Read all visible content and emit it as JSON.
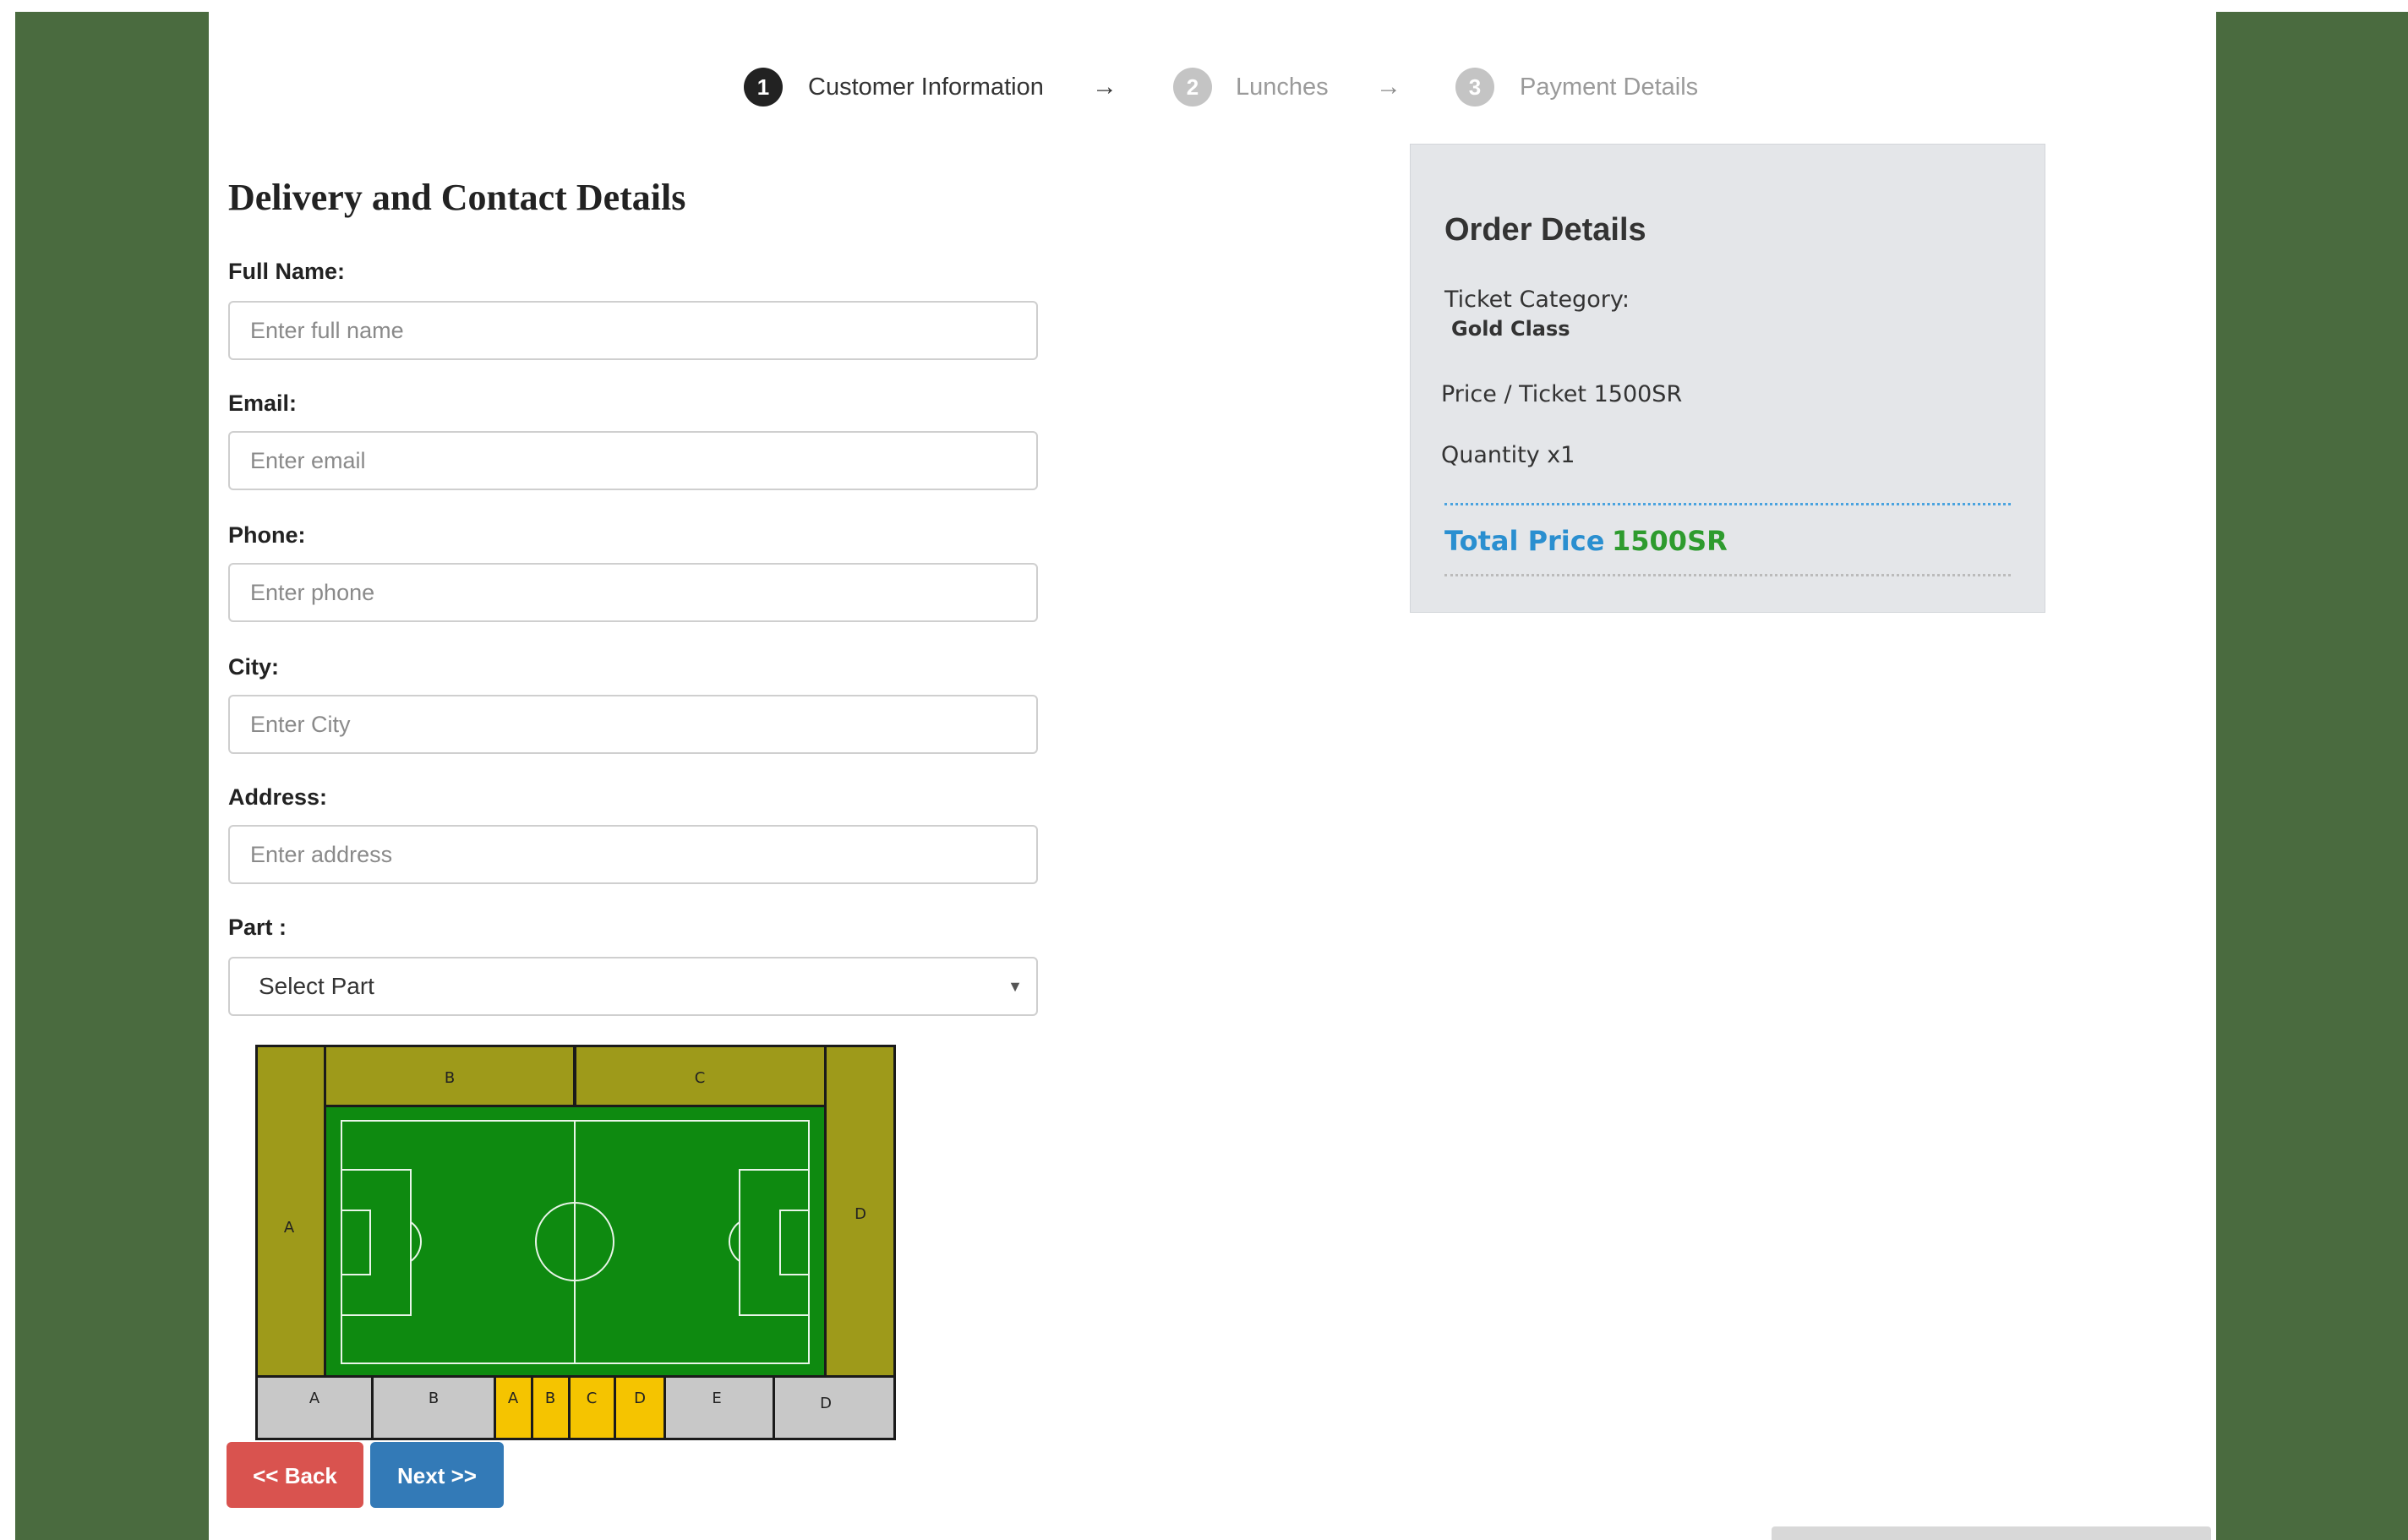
{
  "stepper": [
    {
      "number": "1",
      "label": "Customer Information",
      "active": true
    },
    {
      "number": "2",
      "label": "Lunches",
      "active": false
    },
    {
      "number": "3",
      "label": "Payment Details",
      "active": false
    }
  ],
  "stepper_arrow": "→",
  "form": {
    "heading": "Delivery and Contact Details",
    "fields": [
      {
        "label": "Full Name:",
        "placeholder": "Enter full name",
        "value": ""
      },
      {
        "label": "Email:",
        "placeholder": "Enter email",
        "value": ""
      },
      {
        "label": "Phone:",
        "placeholder": "Enter phone",
        "value": ""
      },
      {
        "label": "City:",
        "placeholder": "Enter City",
        "value": ""
      },
      {
        "label": "Address:",
        "placeholder": "Enter address",
        "value": ""
      }
    ],
    "part": {
      "label": "Part :",
      "selected": "Select Part"
    }
  },
  "stadium": {
    "top_sections": [
      "B",
      "C"
    ],
    "left_section": "A",
    "right_section": "D",
    "bottom_sections": [
      "A",
      "B",
      "A",
      "B",
      "C",
      "D",
      "E",
      "D"
    ],
    "colors": {
      "stand": "#9e9a1a",
      "pitch": "#0e8a10",
      "bottom_grey": "#c8c8c8",
      "bottom_yellow": "#f5c400"
    }
  },
  "buttons": {
    "back": "<< Back",
    "next": "Next >>"
  },
  "order": {
    "title": "Order Details",
    "category_label": "Ticket Category:",
    "category_value": "Gold Class",
    "price_line": "Price / Ticket 1500SR",
    "quantity_line": "Quantity x1",
    "total_label": "Total Price",
    "total_value": "1500SR"
  },
  "colors": {
    "page_side": "#4a6b3f",
    "step_active": "#222222",
    "step_inactive": "#c4c4c4",
    "back_button": "#d9534f",
    "next_button": "#337ab7",
    "total_label": "#2a8fd0",
    "total_value": "#2e9b2e"
  }
}
